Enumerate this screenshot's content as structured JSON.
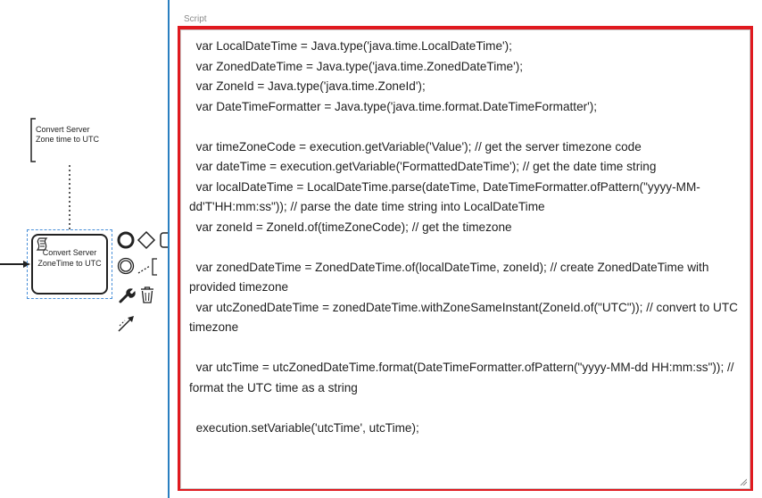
{
  "diagram": {
    "annotation_text": "Convert Server Zone time to UTC",
    "task_label": "Convert Server ZoneTime to UTC"
  },
  "context_pad": {
    "items": [
      "end-event-icon",
      "gateway-icon",
      "task-icon",
      "intermediate-event-icon",
      "text-annotation-icon",
      "wrench-icon",
      "trash-icon",
      "connect-icon"
    ]
  },
  "properties": {
    "script_label": "Script",
    "script_lines": [
      "  var LocalDateTime = Java.type('java.time.LocalDateTime');",
      "  var ZonedDateTime = Java.type('java.time.ZonedDateTime');",
      "  var ZoneId = Java.type('java.time.ZoneId');",
      "  var DateTimeFormatter = Java.type('java.time.format.DateTimeFormatter');",
      "",
      "  var timeZoneCode = execution.getVariable('Value'); // get the server timezone code",
      "  var dateTime = execution.getVariable('FormattedDateTime'); // get the date time string",
      "  var localDateTime = LocalDateTime.parse(dateTime, DateTimeFormatter.ofPattern(\"yyyy-MM-dd'T'HH:mm:ss\")); // parse the date time string into LocalDateTime",
      "  var zoneId = ZoneId.of(timeZoneCode); // get the timezone",
      "",
      "  var zonedDateTime = ZonedDateTime.of(localDateTime, zoneId); // create ZonedDateTime with provided timezone",
      "  var utcZonedDateTime = zonedDateTime.withZoneSameInstant(ZoneId.of(\"UTC\")); // convert to UTC timezone",
      "",
      "  var utcTime = utcZonedDateTime.format(DateTimeFormatter.ofPattern(\"yyyy-MM-dd HH:mm:ss\")); // format the UTC time as a string",
      "",
      "  execution.setVariable('utcTime', utcTime);"
    ]
  }
}
